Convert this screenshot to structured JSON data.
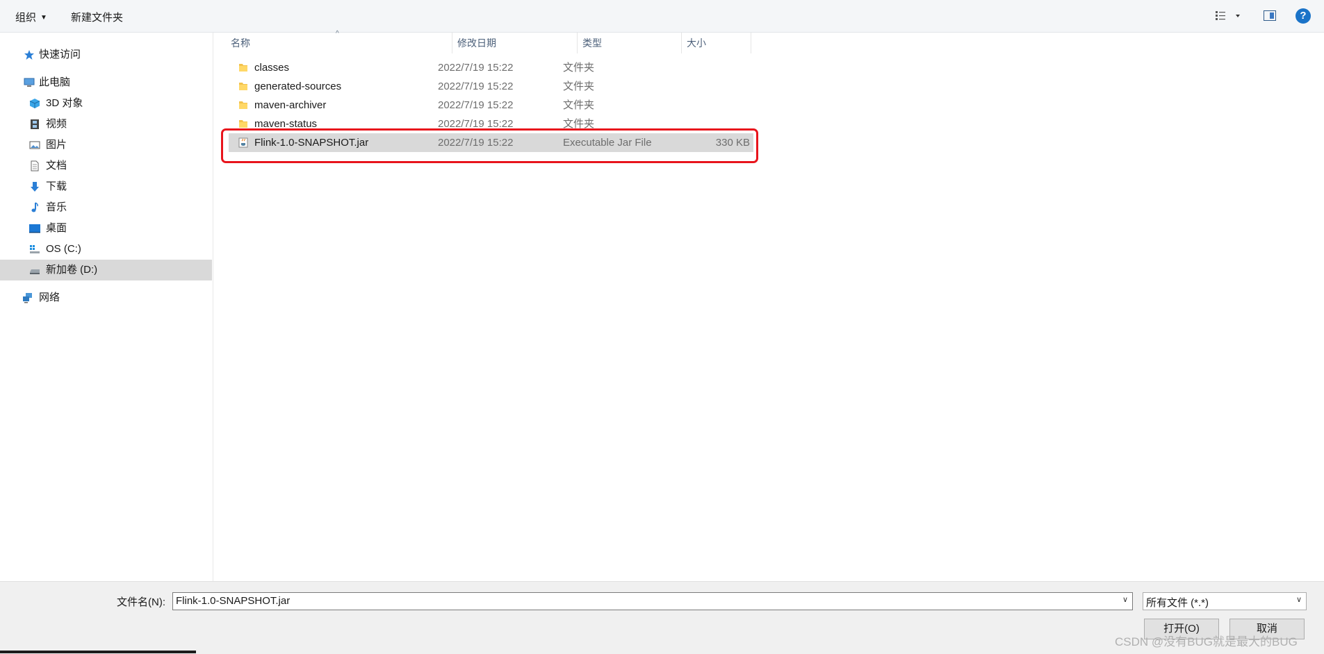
{
  "toolbar": {
    "organize_label": "组织",
    "new_folder_label": "新建文件夹",
    "help_label": "?"
  },
  "sidebar": {
    "items": [
      {
        "label": "快速访问",
        "icon": "star-icon"
      },
      {
        "label": "此电脑",
        "icon": "computer-icon"
      },
      {
        "label": "3D 对象",
        "icon": "cube-icon"
      },
      {
        "label": "视频",
        "icon": "film-icon"
      },
      {
        "label": "图片",
        "icon": "picture-icon"
      },
      {
        "label": "文档",
        "icon": "document-icon"
      },
      {
        "label": "下载",
        "icon": "download-arrow-icon"
      },
      {
        "label": "音乐",
        "icon": "music-note-icon"
      },
      {
        "label": "桌面",
        "icon": "desktop-icon"
      },
      {
        "label": "OS (C:)",
        "icon": "windows-drive-icon"
      },
      {
        "label": "新加卷 (D:)",
        "icon": "drive-icon",
        "selected": true
      },
      {
        "label": "网络",
        "icon": "network-icon"
      }
    ]
  },
  "columns": {
    "name": "名称",
    "date": "修改日期",
    "type": "类型",
    "size": "大小"
  },
  "files": [
    {
      "name": "classes",
      "date": "2022/7/19 15:22",
      "type": "文件夹",
      "size": "",
      "icon": "folder-icon"
    },
    {
      "name": "generated-sources",
      "date": "2022/7/19 15:22",
      "type": "文件夹",
      "size": "",
      "icon": "folder-icon"
    },
    {
      "name": "maven-archiver",
      "date": "2022/7/19 15:22",
      "type": "文件夹",
      "size": "",
      "icon": "folder-icon"
    },
    {
      "name": "maven-status",
      "date": "2022/7/19 15:22",
      "type": "文件夹",
      "size": "",
      "icon": "folder-icon"
    },
    {
      "name": "Flink-1.0-SNAPSHOT.jar",
      "date": "2022/7/19 15:22",
      "type": "Executable Jar File",
      "size": "330 KB",
      "icon": "java-jar-icon",
      "selected": true
    }
  ],
  "footer": {
    "filename_label": "文件名(N):",
    "filename_value": "Flink-1.0-SNAPSHOT.jar",
    "filetype_value": "所有文件 (*.*)",
    "open_label": "打开(O)",
    "cancel_label": "取消"
  },
  "watermark": "CSDN @没有BUG就是最大的BUG",
  "colors": {
    "highlight_border": "#e8141c",
    "selection_bg": "#d9d9d9",
    "help_blue": "#1a73c8"
  }
}
